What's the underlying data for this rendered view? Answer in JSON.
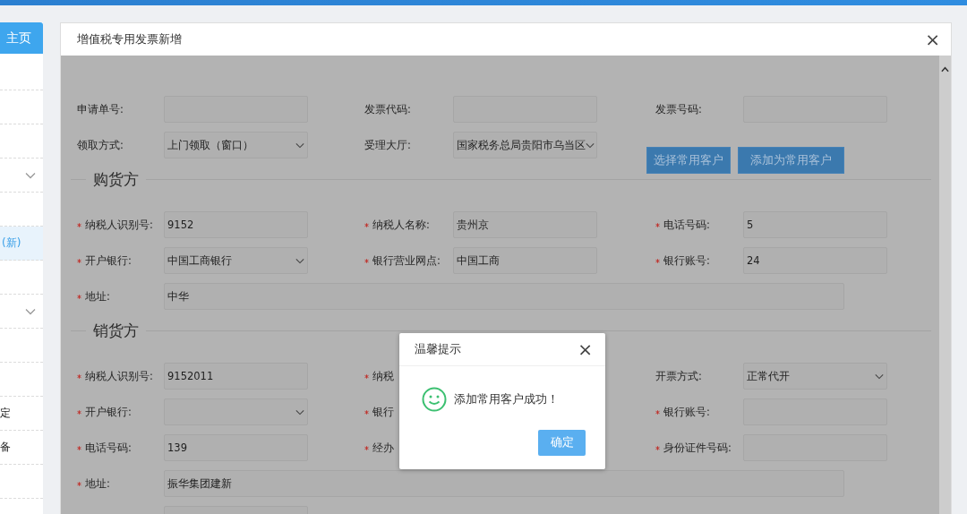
{
  "sidebar": {
    "items": [
      {
        "kind": "home",
        "label": "主页",
        "selected": false
      },
      {
        "kind": "blank",
        "selected": false
      },
      {
        "kind": "blank",
        "selected": false
      },
      {
        "kind": "blank",
        "selected": false
      },
      {
        "kind": "group",
        "selected": false
      },
      {
        "kind": "blank",
        "selected": false
      },
      {
        "kind": "link",
        "label": "(新)",
        "selected": true
      },
      {
        "kind": "blank",
        "selected": false
      },
      {
        "kind": "group",
        "selected": false
      },
      {
        "kind": "blank",
        "selected": false
      },
      {
        "kind": "blank",
        "selected": false
      },
      {
        "kind": "link",
        "label": "定",
        "selected": false
      },
      {
        "kind": "link",
        "label": "备",
        "selected": false
      },
      {
        "kind": "blank",
        "selected": false
      }
    ]
  },
  "dialog": {
    "title": "增值税专用发票新增",
    "close": "×",
    "form": {
      "rows": [
        {
          "fields": [
            {
              "kind": "input",
              "label": "申请单号:",
              "required": false
            },
            {
              "kind": "input",
              "label": "发票代码:",
              "required": false
            },
            {
              "kind": "input",
              "label": "发票号码:",
              "required": false
            }
          ]
        },
        {
          "fields": [
            {
              "kind": "select",
              "label": "领取方式:",
              "required": false,
              "value": "上门领取（窗口）"
            },
            {
              "kind": "select",
              "label": "受理大厅:",
              "required": false,
              "value": "国家税务总局贵阳市乌当区"
            }
          ],
          "buttons": [
            "选择常用客户",
            "添加为常用客户"
          ]
        }
      ],
      "sections": [
        {
          "title": "购货方",
          "rows": [
            {
              "fields": [
                {
                  "kind": "input",
                  "label": "纳税人识别号:",
                  "required": true,
                  "value": "9152"
                },
                {
                  "kind": "input",
                  "label": "纳税人名称:",
                  "required": true,
                  "value": "贵州京"
                },
                {
                  "kind": "input",
                  "label": "电话号码:",
                  "required": true,
                  "value": "5"
                }
              ]
            },
            {
              "fields": [
                {
                  "kind": "select",
                  "label": "开户银行:",
                  "required": true,
                  "value": "中国工商银行"
                },
                {
                  "kind": "input",
                  "label": "银行营业网点:",
                  "required": true,
                  "value": "中国工商"
                },
                {
                  "kind": "input",
                  "label": "银行账号:",
                  "required": true,
                  "value": "24"
                }
              ]
            },
            {
              "fields": [
                {
                  "kind": "wide",
                  "label": "地址:",
                  "required": true,
                  "value": "中华"
                }
              ]
            }
          ]
        },
        {
          "title": "销货方",
          "rows": [
            {
              "fields": [
                {
                  "kind": "input",
                  "label": "纳税人识别号:",
                  "required": true,
                  "value": "9152011"
                },
                {
                  "kind": "covered",
                  "label": "纳税",
                  "required": true
                },
                {
                  "kind": "select",
                  "label": "开票方式:",
                  "required": false,
                  "value": "正常代开"
                }
              ]
            },
            {
              "fields": [
                {
                  "kind": "select",
                  "label": "开户银行:",
                  "required": true
                },
                {
                  "kind": "covered",
                  "label": "银行",
                  "required": true
                },
                {
                  "kind": "input",
                  "label": "银行账号:",
                  "required": true
                }
              ]
            },
            {
              "fields": [
                {
                  "kind": "input",
                  "label": "电话号码:",
                  "required": true,
                  "value": "139"
                },
                {
                  "kind": "covered",
                  "label": "经办",
                  "required": true
                },
                {
                  "kind": "input",
                  "label": "身份证件号码:",
                  "required": true
                }
              ]
            },
            {
              "fields": [
                {
                  "kind": "wide",
                  "label": "地址:",
                  "required": true,
                  "value": "振华集团建新"
                }
              ]
            },
            {
              "fields": [
                {
                  "kind": "input",
                  "required": false
                }
              ]
            }
          ]
        }
      ]
    }
  },
  "message": {
    "title": "温馨提示",
    "close": "×",
    "text": "添加常用客户成功！",
    "button": "确定"
  }
}
